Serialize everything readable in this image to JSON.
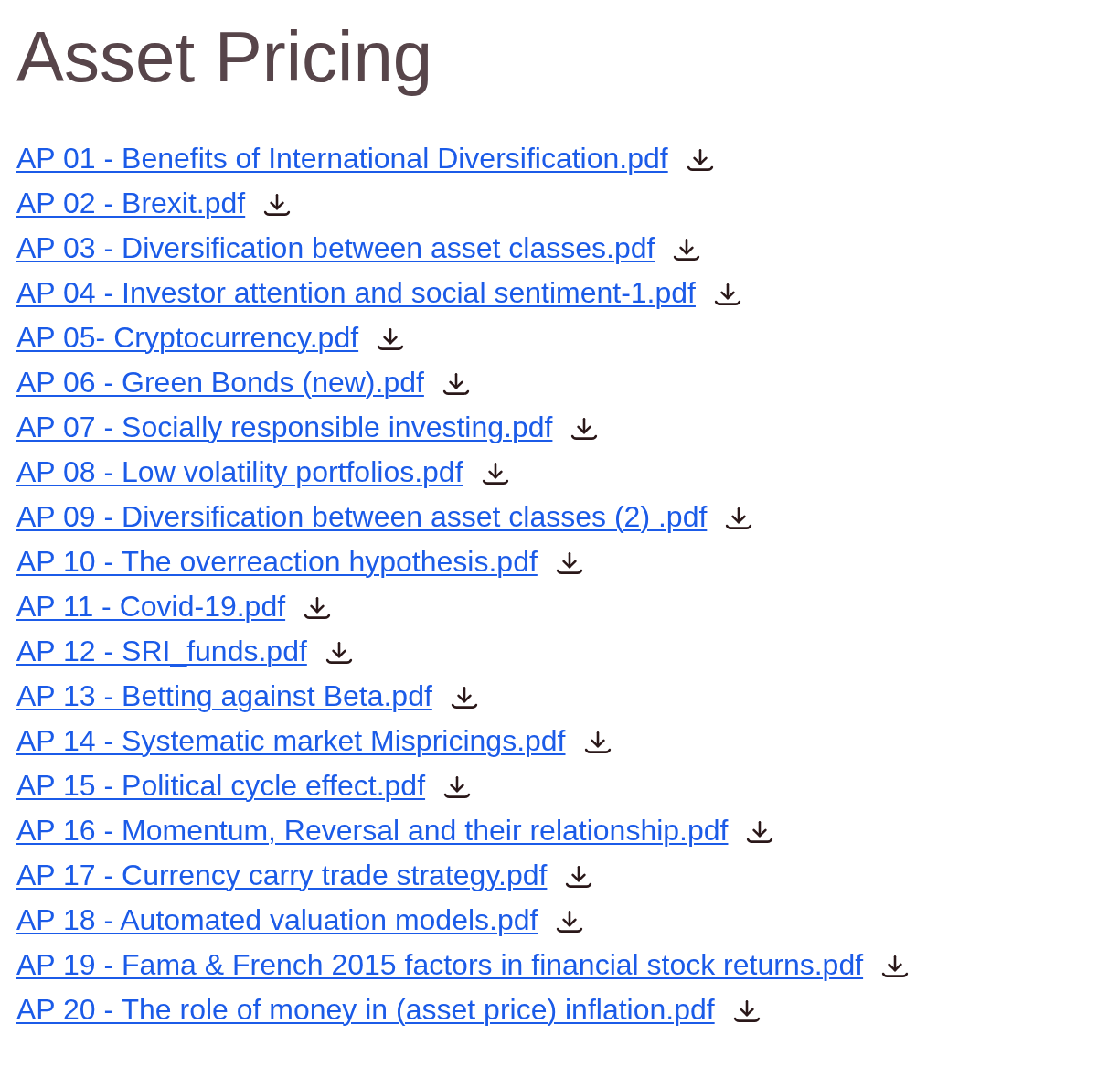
{
  "title": "Asset Pricing",
  "files": [
    {
      "name": "AP 01 - Benefits of International Diversification.pdf"
    },
    {
      "name": "AP 02 - Brexit.pdf"
    },
    {
      "name": "AP 03 - Diversification between asset classes.pdf"
    },
    {
      "name": "AP 04 - Investor attention and social sentiment-1.pdf"
    },
    {
      "name": "AP 05- Cryptocurrency.pdf"
    },
    {
      "name": "AP 06 - Green Bonds (new).pdf"
    },
    {
      "name": "AP 07 - Socially responsible investing.pdf"
    },
    {
      "name": "AP 08 - Low volatility portfolios.pdf"
    },
    {
      "name": "AP 09 - Diversification between asset classes (2) .pdf"
    },
    {
      "name": "AP 10 - The overreaction hypothesis.pdf"
    },
    {
      "name": "AP 11 - Covid-19.pdf"
    },
    {
      "name": "AP 12 - SRI_funds.pdf"
    },
    {
      "name": "AP 13 - Betting against Beta.pdf"
    },
    {
      "name": "AP 14 - Systematic market Mispricings.pdf"
    },
    {
      "name": "AP 15 - Political cycle effect.pdf"
    },
    {
      "name": "AP 16 - Momentum, Reversal and their relationship.pdf"
    },
    {
      "name": "AP 17 - Currency carry trade strategy.pdf"
    },
    {
      "name": "AP 18 - Automated valuation models.pdf"
    },
    {
      "name": "AP 19 - Fama & French 2015 factors in financial stock returns.pdf"
    },
    {
      "name": "AP 20 - The role of money in (asset price) inflation.pdf"
    }
  ]
}
